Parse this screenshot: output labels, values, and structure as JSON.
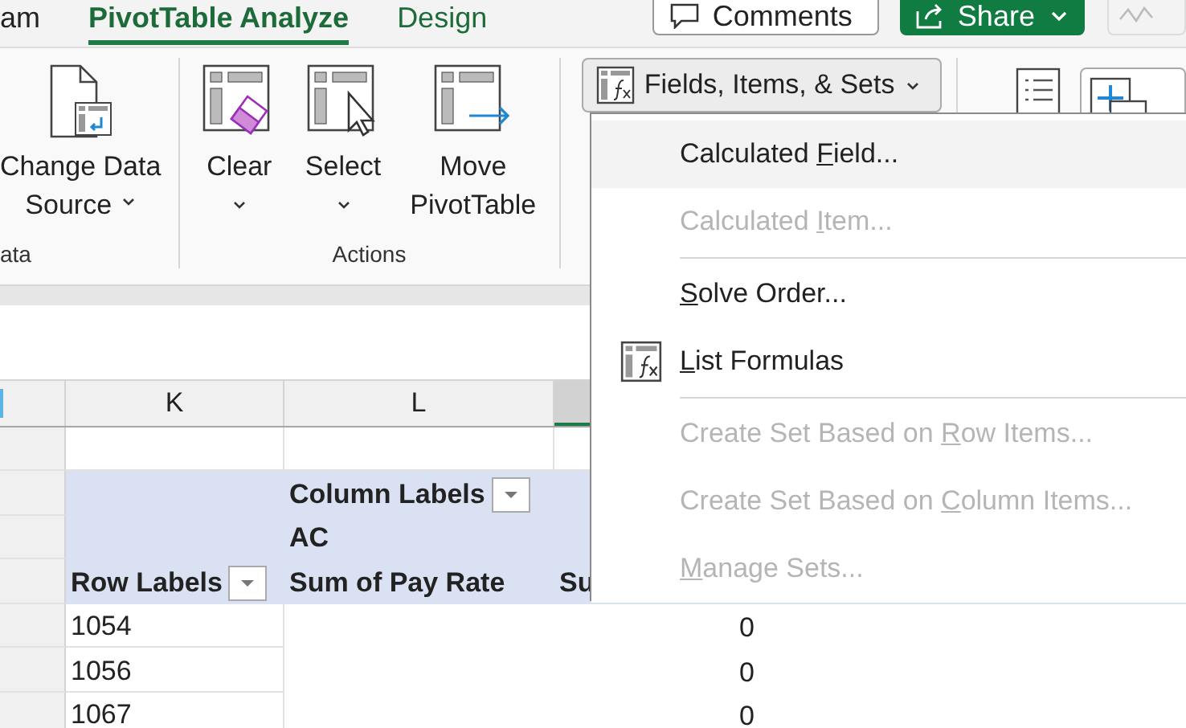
{
  "ribbon_tabs": [
    {
      "label": "am",
      "selected": false
    },
    {
      "label": "PivotTable Analyze",
      "selected": true
    },
    {
      "label": "Design",
      "selected": false
    }
  ],
  "comments_button": "Comments",
  "share_button": "Share",
  "groups": [
    {
      "label": "ata",
      "buttons": [
        {
          "lines": [
            "Change Data",
            "Source"
          ],
          "dropdown": true
        }
      ]
    },
    {
      "label": "Actions",
      "buttons": [
        {
          "lines": [
            "Clear"
          ],
          "dropdown": true
        },
        {
          "lines": [
            "Select"
          ],
          "dropdown": true
        },
        {
          "lines": [
            "Move",
            "PivotTable"
          ],
          "dropdown": false
        }
      ]
    }
  ],
  "fields_button": {
    "label": "Fields, Items, & Sets"
  },
  "menu": [
    {
      "kind": "item",
      "before": "Calculated ",
      "key": "F",
      "after": "ield...",
      "disabled": false,
      "highlighted": true
    },
    {
      "kind": "item",
      "before": "Calculated ",
      "key": "I",
      "after": "tem...",
      "disabled": true,
      "highlighted": false
    },
    {
      "kind": "separator"
    },
    {
      "kind": "item",
      "key": "S",
      "after": "olve Order...",
      "disabled": false,
      "highlighted": false
    },
    {
      "kind": "icon_item",
      "key": "L",
      "after": "ist Formulas",
      "disabled": false,
      "highlighted": false
    },
    {
      "kind": "separator"
    },
    {
      "kind": "item",
      "before": "Create Set Based on ",
      "key": "R",
      "after": "ow Items...",
      "disabled": true,
      "highlighted": false
    },
    {
      "kind": "item",
      "before": "Create Set Based on ",
      "key": "C",
      "after": "olumn Items...",
      "disabled": true,
      "highlighted": false
    },
    {
      "kind": "item",
      "key": "M",
      "after": "anage Sets...",
      "disabled": true,
      "highlighted": false
    }
  ],
  "columns": [
    {
      "label": "K",
      "selected": false
    },
    {
      "label": "L",
      "selected": false
    },
    {
      "selected": true
    }
  ],
  "pivot_header": [
    {
      "l": "Column Labels",
      "l_filter": true
    },
    {
      "l": "AC"
    },
    {
      "k": "Row Labels",
      "k_filter": true,
      "l": "Sum of Pay Rate",
      "m": "Su"
    }
  ],
  "rows": [
    {
      "label": "1054",
      "value": "0"
    },
    {
      "label": "1056",
      "value": "0"
    },
    {
      "label": "1067",
      "value": "0"
    }
  ]
}
